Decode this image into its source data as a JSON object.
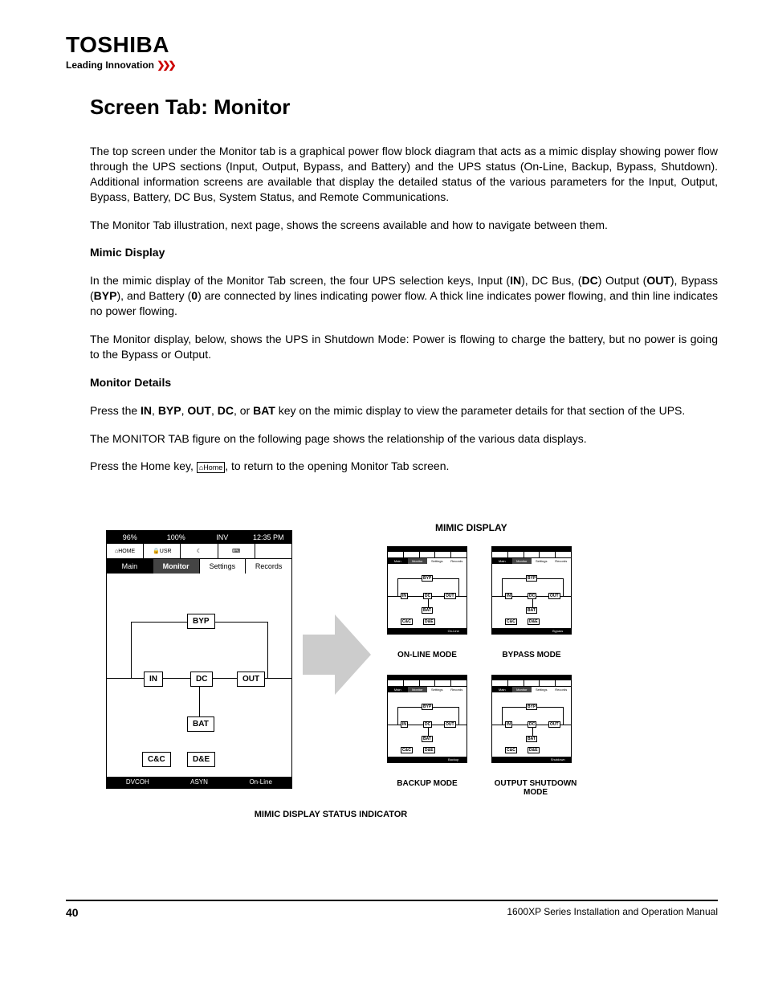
{
  "brand": {
    "name": "TOSHIBA",
    "tagline": "Leading Innovation"
  },
  "title": "Screen Tab: Monitor",
  "para1": "The top screen under the Monitor tab is a graphical power flow block diagram that acts as a mimic display showing power flow through the UPS sections (Input, Output, Bypass, and Battery) and the UPS status (On-Line, Backup, Bypass, Shutdown).  Additional information screens are available that display the detailed status of the various parameters for the Input, Output, Bypass, Battery, DC Bus, System Status, and Remote Communications.",
  "para2": "The Monitor Tab illustration, next page, shows the screens available and how to navigate between them.",
  "mimic_head": "Mimic Display",
  "para3a": "In the mimic display of the Monitor Tab screen, the four UPS selection keys, Input (",
  "para3b": "), DC Bus, (",
  "para3c": ") Output (",
  "para3d": "), Bypass (",
  "para3e": "), and Battery (",
  "para3f": ") are connected by lines indicating power flow.  A thick line indicates power flowing, and thin line indicates no power flowing.",
  "keys": {
    "in": "IN",
    "dc": "DC",
    "out": "OUT",
    "byp": "BYP",
    "zero": "0"
  },
  "para4": "The Monitor display, below, shows the UPS in Shutdown Mode: Power is flowing to charge the battery, but no power is going to the Bypass or Output.",
  "details_head": "Monitor Details",
  "para5a": "Press the ",
  "para5b": " key on the mimic display to view the parameter details for that section of the UPS.",
  "keys2": [
    "IN",
    "BYP",
    "OUT",
    "DC",
    "BAT"
  ],
  "para6": "The MONITOR TAB figure on the following page shows the relationship of the various data displays.",
  "para7a": "Press the Home key, ",
  "para7b": ", to return to the opening Monitor Tab screen.",
  "home_btn": "⌂Home",
  "mimic": {
    "statusTop": [
      "96%",
      "100%",
      "INV",
      "12:35 PM"
    ],
    "icons": [
      "⌂HOME",
      "🔒USR",
      "☾",
      "⌨"
    ],
    "tabs": [
      "Main",
      "Monitor",
      "Settings",
      "Records"
    ],
    "blocks": {
      "byp": "BYP",
      "in": "IN",
      "dc": "DC",
      "out": "OUT",
      "bat": "BAT",
      "cc": "C&C",
      "de": "D&E"
    },
    "statusBottom": [
      "DVCOH",
      "ASYN",
      "On-Line"
    ]
  },
  "mimic_title": "MIMIC DISPLAY",
  "modes": {
    "online": "ON-LINE MODE",
    "bypass": "BYPASS MODE",
    "backup": "BACKUP MODE",
    "shutdown": "OUTPUT SHUTDOWN MODE"
  },
  "mini_status": {
    "online": "On-Line",
    "bypass": "Bypass",
    "backup": "Backup",
    "shutdown": "Shutdown"
  },
  "indicator": "MIMIC DISPLAY STATUS INDICATOR",
  "footer": {
    "page": "40",
    "doc": "1600XP Series Installation and Operation Manual"
  }
}
